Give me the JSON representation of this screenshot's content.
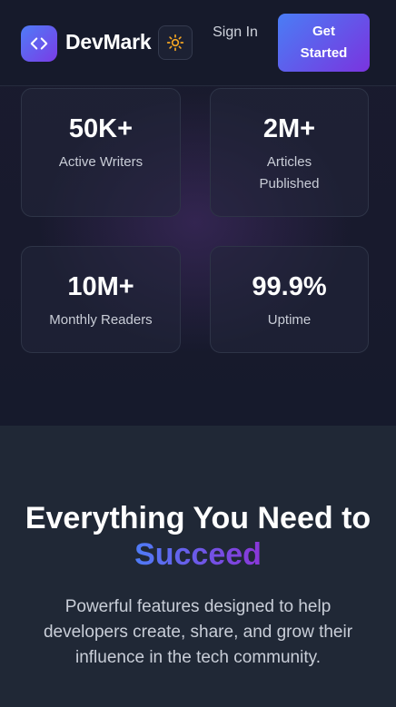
{
  "header": {
    "brand": "DevMark",
    "signin_label": "Sign In",
    "cta_label": "Get Started",
    "icons": {
      "logo": "code-brackets-icon",
      "theme": "sun-icon"
    }
  },
  "stats": [
    {
      "value": "50K+",
      "label": "Active Writers"
    },
    {
      "value": "2M+",
      "label": "Articles Published"
    },
    {
      "value": "10M+",
      "label": "Monthly Readers"
    },
    {
      "value": "99.9%",
      "label": "Uptime"
    }
  ],
  "features": {
    "title_prefix": "Everything You Need to",
    "title_accent": "Succeed",
    "description": "Powerful features designed to help developers create, share, and grow their influence in the tech community."
  },
  "colors": {
    "accent_start": "#4f7cf7",
    "accent_end": "#7a34df",
    "sun": "#f5a623",
    "hero_bg": "#181a2d",
    "section_bg": "#202836"
  }
}
